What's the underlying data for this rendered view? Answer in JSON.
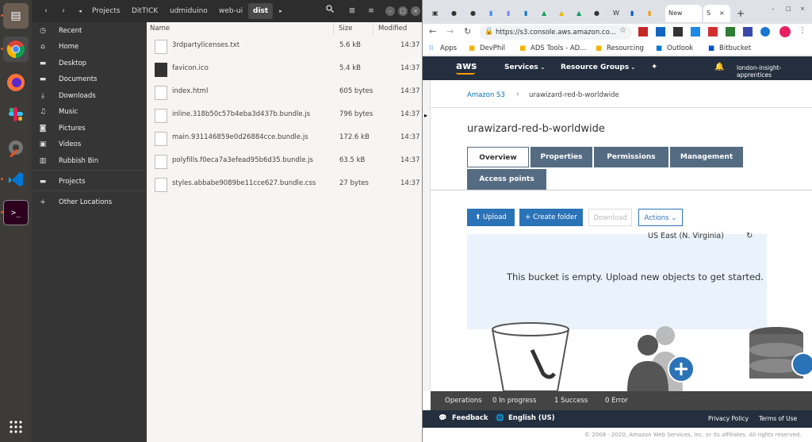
{
  "file_manager": {
    "breadcrumbs": [
      "Projects",
      "DitTICK",
      "udmiduino",
      "web-ui",
      "dist"
    ],
    "sidebar": [
      {
        "icon": "clock-icon",
        "label": "Recent"
      },
      {
        "icon": "home-icon",
        "label": "Home"
      },
      {
        "icon": "folder-icon",
        "label": "Desktop"
      },
      {
        "icon": "folder-icon",
        "label": "Documents"
      },
      {
        "icon": "download-icon",
        "label": "Downloads"
      },
      {
        "icon": "music-icon",
        "label": "Music"
      },
      {
        "icon": "camera-icon",
        "label": "Pictures"
      },
      {
        "icon": "video-icon",
        "label": "Videos"
      },
      {
        "icon": "trash-icon",
        "label": "Rubbish Bin"
      },
      {
        "icon": "folder-icon",
        "label": "Projects"
      },
      {
        "icon": "plus-icon",
        "label": "Other Locations"
      }
    ],
    "columns": {
      "name": "Name",
      "size": "Size",
      "modified": "Modified"
    },
    "files": [
      {
        "name": "3rdpartylicenses.txt",
        "size": "5.6 kB",
        "modified": "14:37"
      },
      {
        "name": "favicon.ico",
        "size": "5.4 kB",
        "modified": "14:37"
      },
      {
        "name": "index.html",
        "size": "605 bytes",
        "modified": "14:37"
      },
      {
        "name": "inline.318b50c57b4eba3d437b.bundle.js",
        "size": "796 bytes",
        "modified": "14:37"
      },
      {
        "name": "main.931146859e0d26884cce.bundle.js",
        "size": "172.6 kB",
        "modified": "14:37"
      },
      {
        "name": "polyfills.f0eca7a3efead95b6d35.bundle.js",
        "size": "63.5 kB",
        "modified": "14:37"
      },
      {
        "name": "styles.abbabe9089be11cce627.bundle.css",
        "size": "27 bytes",
        "modified": "14:37"
      }
    ]
  },
  "browser": {
    "active_tab": "New",
    "active_tab2": "S",
    "url": "https://s3.console.aws.amazon.co...",
    "bookmarks": [
      "Apps",
      "DevPhil",
      "ADS Tools - AD...",
      "Resourcing",
      "Outlook",
      "Bitbucket"
    ],
    "aws": {
      "logo": "aws",
      "services": "Services",
      "resource_groups": "Resource Groups",
      "account": "london-insight-apprentices",
      "breadcrumb_root": "Amazon S3",
      "breadcrumb_sep": "›",
      "bucket_name": "urawizard-red-b-worldwide",
      "tabs": [
        "Overview",
        "Properties",
        "Permissions",
        "Management",
        "Access points"
      ],
      "upload": "Upload",
      "create_folder": "Create folder",
      "download": "Download",
      "actions": "Actions",
      "region": "US East (N. Virginia)",
      "empty_message": "This bucket is empty. Upload new objects to get started.",
      "ops": {
        "operations": "Operations",
        "in_progress": "0 In progress",
        "success": "1 Success",
        "error": "0 Error"
      },
      "footer": {
        "feedback": "Feedback",
        "language": "English (US)",
        "privacy": "Privacy Policy",
        "terms": "Terms of Use"
      },
      "copyright": "© 2008 - 2020, Amazon Web Services, Inc. or its affiliates. All rights reserved."
    }
  }
}
